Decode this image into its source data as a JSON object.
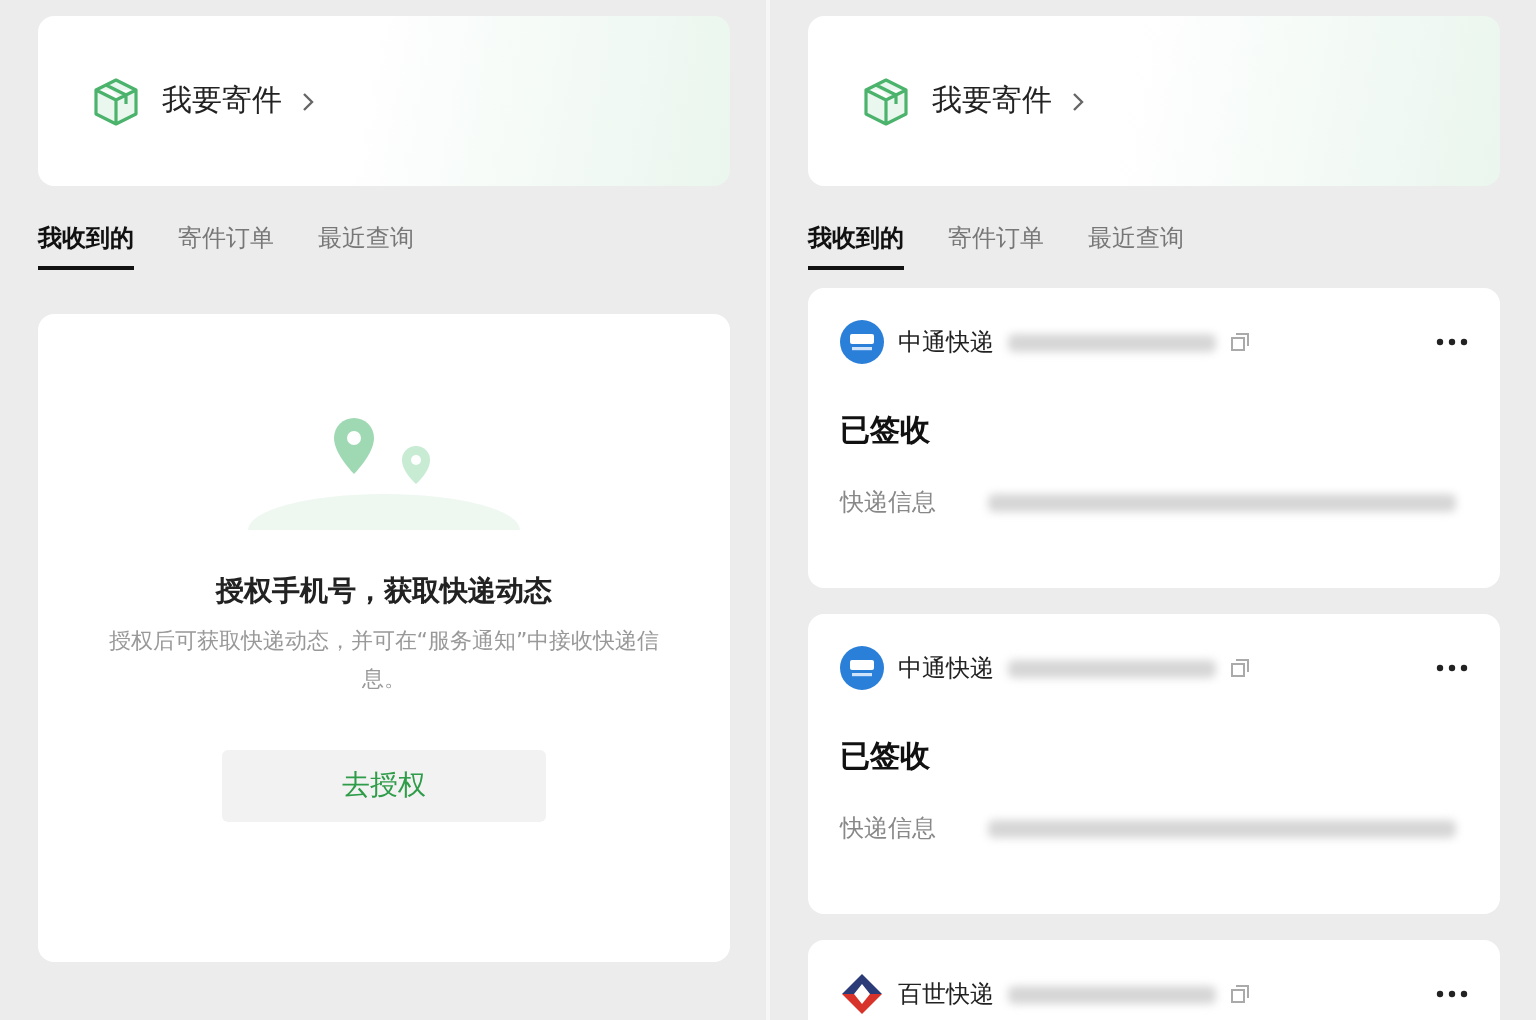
{
  "panels": [
    {
      "send_card": {
        "label": "我要寄件"
      },
      "tabs": [
        {
          "label": "我收到的",
          "selected": true
        },
        {
          "label": "寄件订单",
          "selected": false
        },
        {
          "label": "最近查询",
          "selected": false
        }
      ],
      "content": {
        "kind": "auth",
        "title": "授权手机号，获取快递动态",
        "description": "授权后可获取快递动态，并可在“服务通知”中接收快递信息。",
        "button": "去授权"
      }
    },
    {
      "send_card": {
        "label": "我要寄件"
      },
      "tabs": [
        {
          "label": "我收到的",
          "selected": true
        },
        {
          "label": "寄件订单",
          "selected": false
        },
        {
          "label": "最近查询",
          "selected": false
        }
      ],
      "content": {
        "kind": "list",
        "parcels": [
          {
            "kind": "zto",
            "carrier": "中通快递",
            "status": "已签收",
            "info_label": "快递信息"
          },
          {
            "kind": "zto",
            "carrier": "中通快递",
            "status": "已签收",
            "info_label": "快递信息"
          },
          {
            "kind": "best",
            "carrier": "百世快递"
          }
        ]
      }
    }
  ]
}
